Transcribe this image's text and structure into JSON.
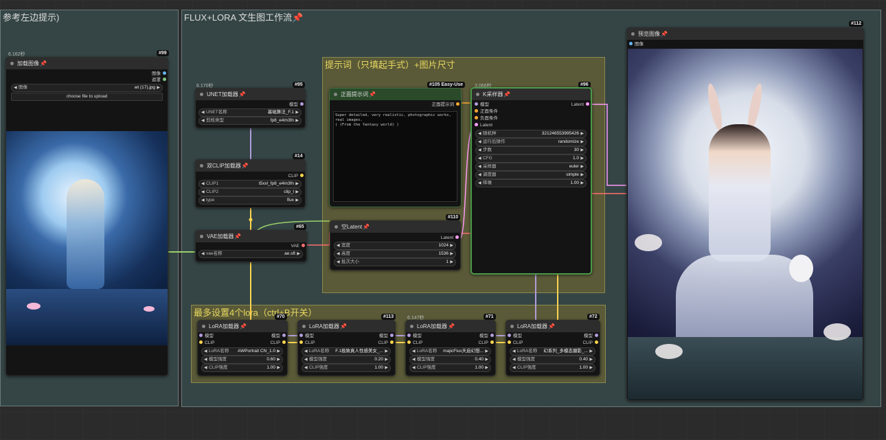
{
  "groups": {
    "left": {
      "title": "参考左边提示)"
    },
    "main": {
      "title": "FLUX+LORA 文生图工作流"
    },
    "prompt": {
      "title": "提示词（只填起手式）+图片尺寸"
    },
    "lora": {
      "title": "最多设置4个lora（ctrl+B开关）"
    }
  },
  "load_image": {
    "time": "6.162秒",
    "badge": "#99",
    "title": "加载图像",
    "out1": "图像",
    "out2": "遮罩",
    "image_label": "图像",
    "image_value": "wt (17).jpg",
    "upload": "choose file to upload"
  },
  "unet": {
    "time": "6.170秒",
    "badge": "#95",
    "title": "UNET加载器",
    "out": "模型",
    "w1_label": "UNET名称",
    "w1_value": "基础算法_F.1",
    "w2_label": "剪枝类型",
    "w2_value": "fp8_e4m3fn"
  },
  "dualclip": {
    "badge": "#14",
    "title": "双CLIP加载器",
    "out": "CLIP",
    "w1_label": "CLIP1",
    "w1_value": "t5xxl_fp8_e4m3fn",
    "w2_label": "CLIP2",
    "w2_value": "clip_l",
    "w3_label": "type",
    "w3_value": "flux"
  },
  "vae": {
    "badge": "#65",
    "title": "VAE加载器",
    "out": "VAE",
    "w1_label": "vae名称",
    "w1_value": "ae.sft"
  },
  "positive": {
    "badge": "#105 Easy-Use",
    "title": "正面提示词",
    "out": "正面提示词",
    "text": "Super detailed, very realistic, photographic works, real images.\n( (From the fantasy world) )"
  },
  "empty_latent": {
    "badge": "#110",
    "title": "空Latent",
    "out": "Latent",
    "w1_label": "宽度",
    "w1_value": "1024",
    "w2_label": "高度",
    "w2_value": "1536",
    "w3_label": "批次大小",
    "w3_value": "1"
  },
  "ksampler": {
    "time": "3.066秒",
    "badge": "#96",
    "title": "K采样器",
    "out": "Latent",
    "in1": "模型",
    "in2": "正面条件",
    "in3": "负面条件",
    "in4": "Latent",
    "w": [
      {
        "label": "随机种",
        "value": "321246553995426"
      },
      {
        "label": "运行后操作",
        "value": "randomize"
      },
      {
        "label": "步数",
        "value": "30"
      },
      {
        "label": "CFG",
        "value": "1.0"
      },
      {
        "label": "采样器",
        "value": "euler"
      },
      {
        "label": "调度器",
        "value": "simple"
      },
      {
        "label": "降噪",
        "value": "1.00"
      }
    ]
  },
  "preview": {
    "badge": "#112",
    "title": "预览图像",
    "in": "图像"
  },
  "loras": [
    {
      "badge": "#70",
      "title": "LoRA加载器",
      "name": "AWPortrait CN_1.0",
      "model": "0.60",
      "clip": "1.00"
    },
    {
      "badge": "#113",
      "title": "LoRA加载器",
      "name": "F.1极致真人性感美女_...",
      "model": "0.20",
      "clip": "1.00"
    },
    {
      "badge": "#71",
      "title": "LoRA加载器",
      "time": "6.147秒",
      "name": "majicFlus天启幻想...",
      "model": "0.40",
      "clip": "1.00"
    },
    {
      "badge": "#72",
      "title": "LoRA加载器",
      "name": "幻系列_多模态摄影_...",
      "model": "0.40",
      "clip": "1.00"
    }
  ],
  "lora_labels": {
    "model": "模型",
    "clip": "CLIP",
    "name": "LoRA名称",
    "model_strength": "模型强度",
    "clip_strength": "CLIP强度"
  },
  "colors": {
    "model": "#b39ddb",
    "clip": "#ffd54f",
    "vae": "#ff6e6e",
    "latent": "#ff9cf9",
    "cond": "#ffa931",
    "image": "#64b5f6",
    "group_main": "#3f5555",
    "group_prompt": "#5f5f2a",
    "group_lora": "#5f5f2a"
  }
}
